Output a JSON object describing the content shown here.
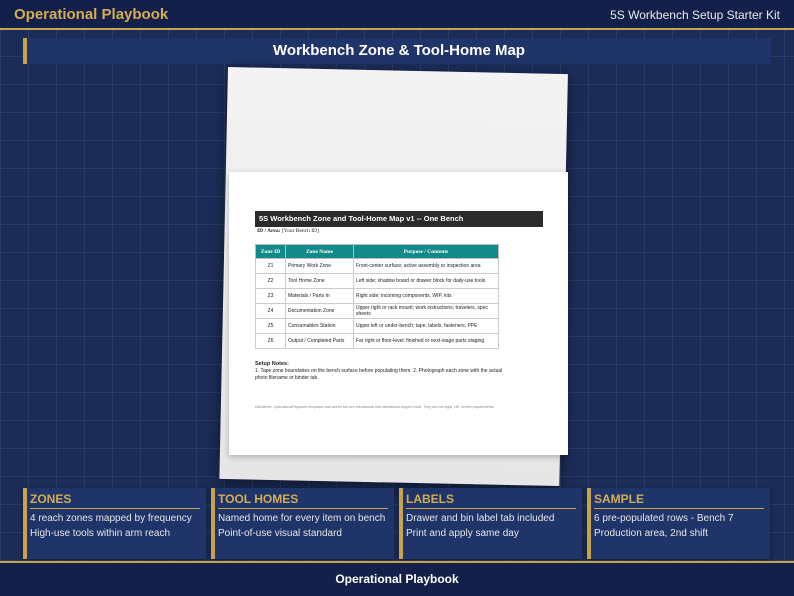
{
  "header": {
    "brand": "Operational Playbook",
    "kit_name": "5S Workbench Setup Starter Kit"
  },
  "title": "Workbench Zone & Tool-Home Map",
  "document": {
    "heading": "5S Workbench Zone and Tool-Home Map v1 -- One Bench",
    "id_label": "ID / Area:",
    "id_value": "[Your Bench ID]",
    "columns": [
      "Zone ID",
      "Zone Name",
      "Purpose / Contents"
    ],
    "rows": [
      {
        "id": "Z1",
        "name": "Primary Work Zone",
        "purpose": "Front-center surface; active assembly or inspection area"
      },
      {
        "id": "Z2",
        "name": "Tool Home Zone",
        "purpose": "Left side; shadow board or drawer block for daily-use tools"
      },
      {
        "id": "Z3",
        "name": "Materials / Parts In",
        "purpose": "Right side; incoming components, WIP, kits"
      },
      {
        "id": "Z4",
        "name": "Documentation Zone",
        "purpose": "Upper right or rack mount; work instructions, travelers, spec sheets"
      },
      {
        "id": "Z5",
        "name": "Consumables Station",
        "purpose": "Upper left or under-bench; tape, labels, fasteners, PPE"
      },
      {
        "id": "Z6",
        "name": "Output / Completed Parts",
        "purpose": "Far right or floor-level; finished or next-stage parts staging"
      }
    ],
    "notes_title": "Setup Notes:",
    "notes_text": "1. Tape zone boundaries on the bench surface before populating them. 2. Photograph each zone with the actual photo filename or binder tab.",
    "disclaimer": "Disclaimer: OperationalPlaybook templates and starter kits are educational and operational support tools. They are not legal, HR, review requirements."
  },
  "cards": [
    {
      "title": "ZONES",
      "line1": "4 reach zones mapped by frequency",
      "line2": "High-use tools within arm reach"
    },
    {
      "title": "TOOL HOMES",
      "line1": "Named home for every item on bench",
      "line2": "Point-of-use visual standard"
    },
    {
      "title": "LABELS",
      "line1": "Drawer and bin label tab included",
      "line2": "Print and apply same day"
    },
    {
      "title": "SAMPLE",
      "line1": "6 pre-populated rows - Bench 7",
      "line2": "Production area, 2nd shift"
    }
  ],
  "footer": "Operational Playbook",
  "colors": {
    "background": "#1b2c57",
    "accent_gold": "#c9a24d",
    "table_header_teal": "#138a8a"
  }
}
